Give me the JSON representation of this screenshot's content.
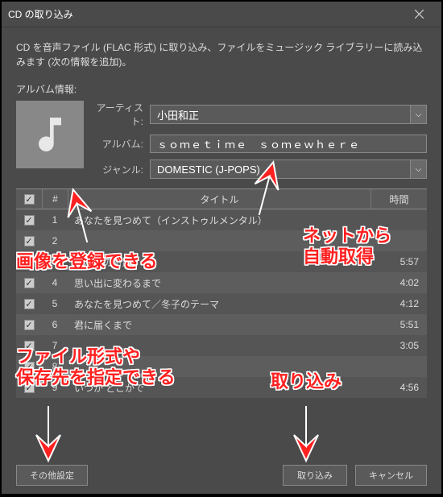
{
  "window": {
    "title": "CD の取り込み",
    "description": "CD を音声ファイル (FLAC 形式) に取り込み、ファイルをミュージック ライブラリーに読み込みます (次の情報を追加)。"
  },
  "album": {
    "section_label": "アルバム情報:",
    "artist_label": "アーティスト:",
    "artist_value": "小田和正",
    "album_label": "アルバム:",
    "album_value": "ｓｏｍｅｔｉｍｅ　ｓｏｍｅｗｈｅｒｅ",
    "genre_label": "ジャンル:",
    "genre_value": "DOMESTIC (J-POPS)"
  },
  "table": {
    "headers": {
      "num": "#",
      "title": "タイトル",
      "time": "時間"
    },
    "rows": [
      {
        "num": "1",
        "title": "あなたを見つめて（インストゥルメンタル）",
        "time": ""
      },
      {
        "num": "2",
        "title": "",
        "time": ""
      },
      {
        "num": "3",
        "title": "ふたつの奇跡",
        "time": "5:57"
      },
      {
        "num": "4",
        "title": "思い出に変わるまで",
        "time": "4:02"
      },
      {
        "num": "5",
        "title": "あなたを見つめて／冬子のテーマ",
        "time": "4:12"
      },
      {
        "num": "6",
        "title": "君に届くまで",
        "time": "5:51"
      },
      {
        "num": "7",
        "title": "",
        "time": "3:05"
      },
      {
        "num": "8",
        "title": "",
        "time": ""
      },
      {
        "num": "9",
        "title": "いつか どこかで",
        "time": "4:56"
      }
    ]
  },
  "buttons": {
    "other": "その他設定",
    "import": "取り込み",
    "cancel": "キャンセル"
  },
  "annotations": {
    "a1": "画像を登録できる",
    "a2": "ネットから\n自動取得",
    "a3": "ファイル形式や\n保存先を指定できる",
    "a4": "取り込み"
  }
}
